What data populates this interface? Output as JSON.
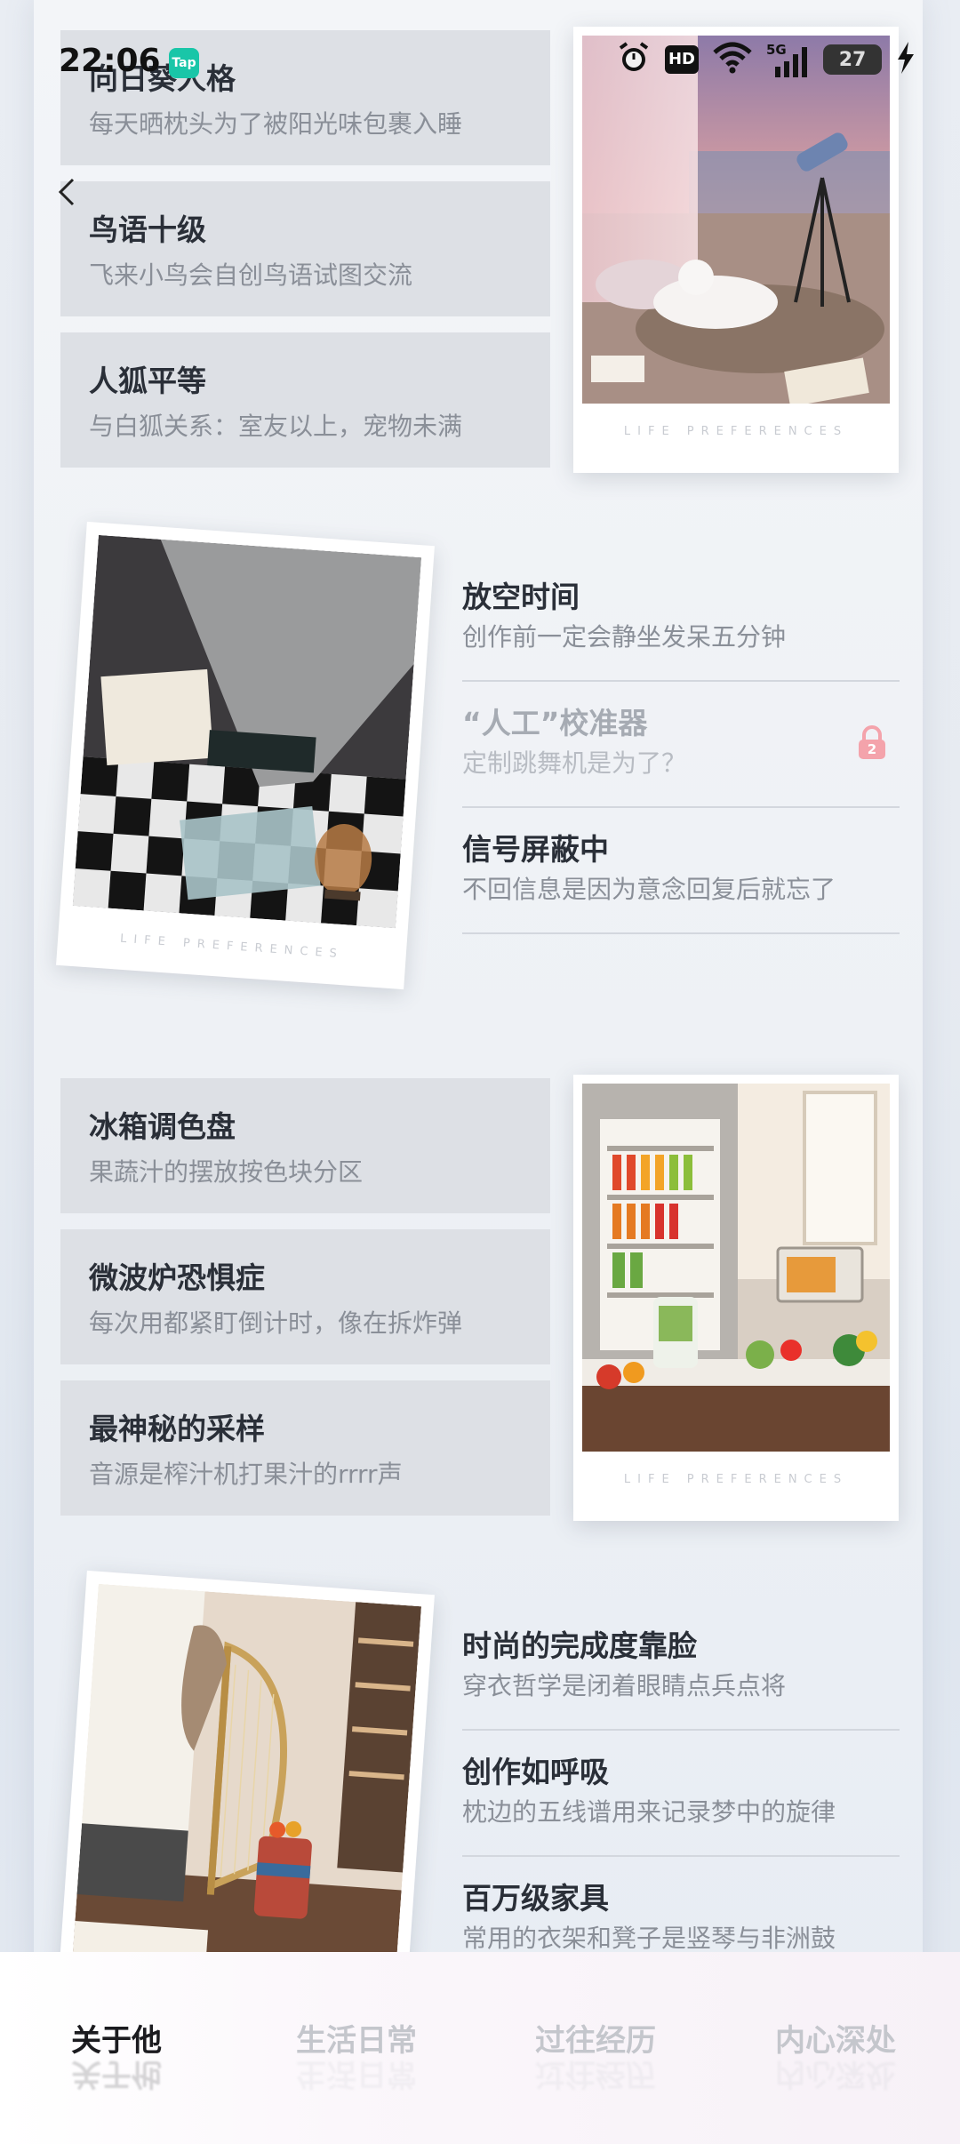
{
  "status_bar": {
    "time": "22:06",
    "app_badge": "Tap",
    "network": "5G",
    "battery": "27"
  },
  "section1": {
    "cards": [
      {
        "title": "向日葵人格",
        "subtitle": "每天晒枕头为了被阳光味包裹入睡"
      },
      {
        "title": "鸟语十级",
        "subtitle": "飞来小鸟会自创鸟语试图交流"
      },
      {
        "title": "人狐平等",
        "subtitle": "与白狐关系：室友以上，宠物未满"
      }
    ],
    "photo_caption": "LIFE PREFERENCES"
  },
  "section2": {
    "photo_caption": "LIFE PREFERENCES",
    "items": [
      {
        "title": "放空时间",
        "subtitle": "创作前一定会静坐发呆五分钟"
      },
      {
        "title": "“人工”校准器",
        "subtitle": "定制跳舞机是为了？",
        "lock_number": "2"
      },
      {
        "title": "信号屏蔽中",
        "subtitle": "不回信息是因为意念回复后就忘了"
      }
    ]
  },
  "section3": {
    "cards": [
      {
        "title": "冰箱调色盘",
        "subtitle": "果蔬汁的摆放按色块分区"
      },
      {
        "title": "微波炉恐惧症",
        "subtitle": "每次用都紧盯倒计时，像在拆炸弹"
      },
      {
        "title": "最神秘的采样",
        "subtitle": "音源是榨汁机打果汁的rrrr声"
      }
    ],
    "photo_caption": "LIFE PREFERENCES"
  },
  "section4": {
    "items": [
      {
        "title": "时尚的完成度靠脸",
        "subtitle": "穿衣哲学是闭着眼睛点兵点将"
      },
      {
        "title": "创作如呼吸",
        "subtitle": "枕边的五线谱用来记录梦中的旋律"
      },
      {
        "title": "百万级家具",
        "subtitle": "常用的衣架和凳子是竖琴与非洲鼓"
      }
    ]
  },
  "tabs": [
    {
      "label": "关于他",
      "active": true
    },
    {
      "label": "生活日常",
      "active": false
    },
    {
      "label": "过往经历",
      "active": false
    },
    {
      "label": "内心深处",
      "active": false
    }
  ],
  "colors": {
    "accent_lock": "#f4a3ab",
    "tab_active": "#1b1b1f",
    "tab_inactive": "#c4c6cc"
  }
}
